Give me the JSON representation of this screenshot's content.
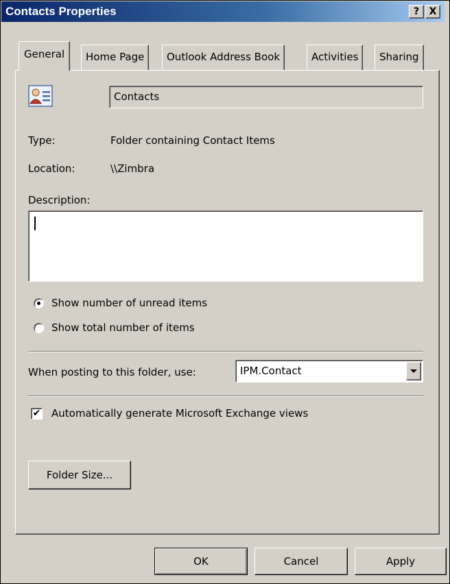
{
  "window": {
    "title": "Contacts Properties",
    "help_label": "?",
    "close_label": "X"
  },
  "tabs": [
    {
      "label": "General",
      "active": true
    },
    {
      "label": "Home Page"
    },
    {
      "label": "Outlook Address Book"
    },
    {
      "label": "Activities"
    },
    {
      "label": "Sharing"
    }
  ],
  "general": {
    "folder_icon": "contacts-card-icon",
    "folder_name": "Contacts",
    "type_label": "Type:",
    "type_value": "Folder containing Contact Items",
    "location_label": "Location:",
    "location_value": "\\\\Zimbra",
    "description_label": "Description:",
    "description_value": "",
    "radio_unread_label": "Show number of unread items",
    "radio_total_label": "Show total number of items",
    "radio_selected": "unread",
    "posting_label": "When posting to this folder, use:",
    "posting_value": "IPM.Contact",
    "auto_generate_label": "Automatically generate Microsoft Exchange views",
    "auto_generate_checked": true,
    "folder_size_label": "Folder Size..."
  },
  "footer": {
    "ok_label": "OK",
    "cancel_label": "Cancel",
    "apply_label": "Apply"
  },
  "colors": {
    "dialog_bg": "#d4d0c8",
    "title_bar": "#0a246a"
  }
}
